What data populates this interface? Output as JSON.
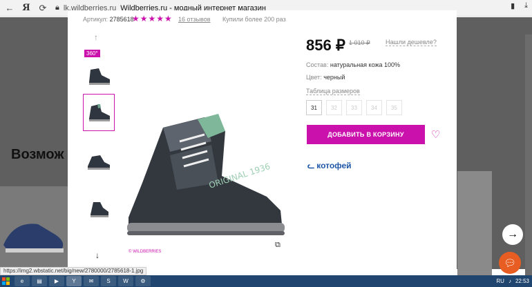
{
  "browser": {
    "domain": "lk.wildberries.ru",
    "title": "Wildberries.ru - модный интернет магазин",
    "back_icon": "arrow-left-icon",
    "ya_logo": "Я"
  },
  "background": {
    "heading": "Возмож"
  },
  "product": {
    "article_label": "Артикул:",
    "article_value": "2785618",
    "stars": "★★★★★",
    "reviews": "16 отзывов",
    "bought": "Купили более 200 раз",
    "badge_360": "360°",
    "price": "856 ₽",
    "old_price": "1 010 ₽",
    "cheaper_link": "Нашли дешевле?",
    "composition_label": "Состав:",
    "composition_value": "натуральная кожа 100%",
    "color_label": "Цвет:",
    "color_value": "черный",
    "size_table": "Таблица размеров",
    "sizes": [
      "31",
      "32",
      "33",
      "34",
      "35"
    ],
    "add_to_cart": "ДОБАВИТЬ В КОРЗИНУ",
    "brand": "котофей",
    "watermark": "© WILDBERRIES",
    "shoe_text": "ORIGINAL 1936"
  },
  "status_url": "https://img2.wbstatic.net/big/new/2780000/2785618-1.jpg",
  "taskbar": {
    "lang": "RU",
    "time": "22:53"
  },
  "colors": {
    "accent": "#cb11ab",
    "brand": "#1f57a6",
    "taskbar": "#20456e"
  }
}
